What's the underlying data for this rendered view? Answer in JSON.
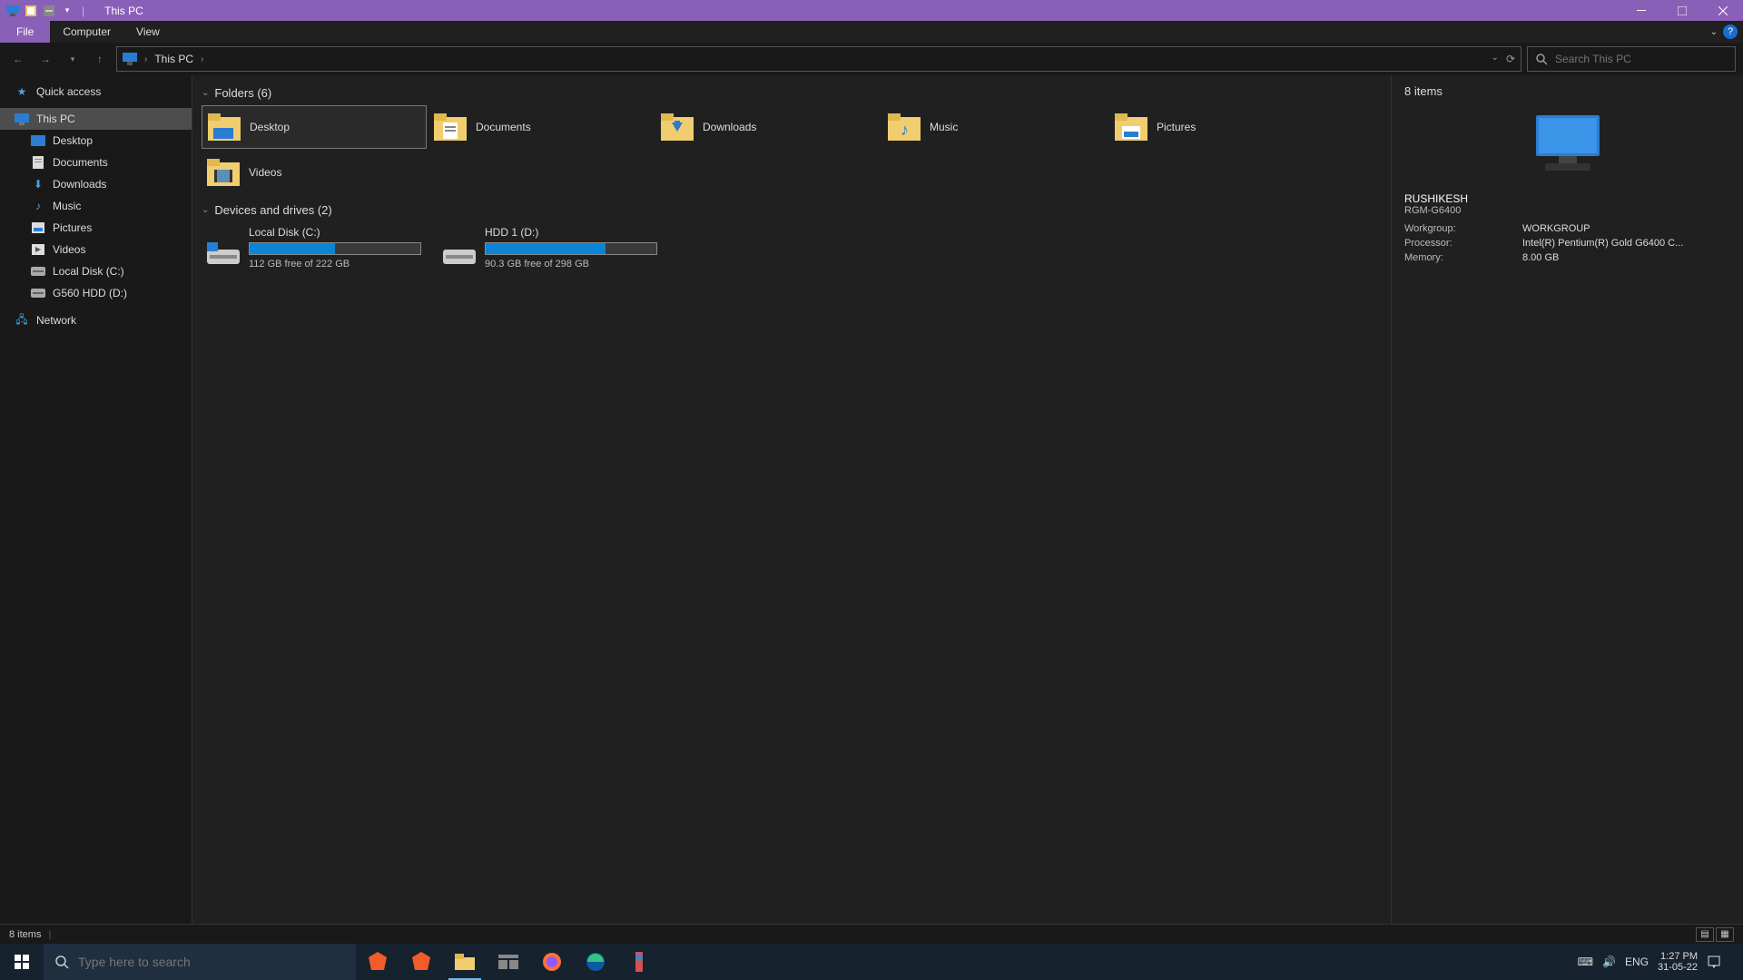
{
  "window": {
    "title": "This PC"
  },
  "ribbon": {
    "file": "File",
    "tabs": [
      "Computer",
      "View"
    ]
  },
  "address": {
    "location": "This PC",
    "search_placeholder": "Search This PC"
  },
  "sidebar": {
    "quick_access": "Quick access",
    "this_pc": "This PC",
    "items": [
      {
        "label": "Desktop"
      },
      {
        "label": "Documents"
      },
      {
        "label": "Downloads"
      },
      {
        "label": "Music"
      },
      {
        "label": "Pictures"
      },
      {
        "label": "Videos"
      },
      {
        "label": "Local Disk (C:)"
      },
      {
        "label": "G560 HDD (D:)"
      }
    ],
    "network": "Network"
  },
  "content": {
    "folders_header": "Folders (6)",
    "folders": [
      {
        "label": "Desktop"
      },
      {
        "label": "Documents"
      },
      {
        "label": "Downloads"
      },
      {
        "label": "Music"
      },
      {
        "label": "Pictures"
      },
      {
        "label": "Videos"
      }
    ],
    "drives_header": "Devices and drives (2)",
    "drives": [
      {
        "name": "Local Disk (C:)",
        "free": "112 GB free of 222 GB",
        "fill": 50
      },
      {
        "name": "HDD 1 (D:)",
        "free": "90.3 GB free of 298 GB",
        "fill": 70
      }
    ]
  },
  "details": {
    "count": "8 items",
    "name": "RUSHIKESH",
    "model": "RGM-G6400",
    "rows": [
      {
        "k": "Workgroup:",
        "v": "WORKGROUP"
      },
      {
        "k": "Processor:",
        "v": "Intel(R) Pentium(R) Gold G6400 C..."
      },
      {
        "k": "Memory:",
        "v": "8.00 GB"
      }
    ]
  },
  "statusbar": {
    "text": "8 items"
  },
  "taskbar": {
    "search_placeholder": "Type here to search",
    "lang": "ENG",
    "time": "1:27 PM",
    "date": "31-05-22"
  }
}
